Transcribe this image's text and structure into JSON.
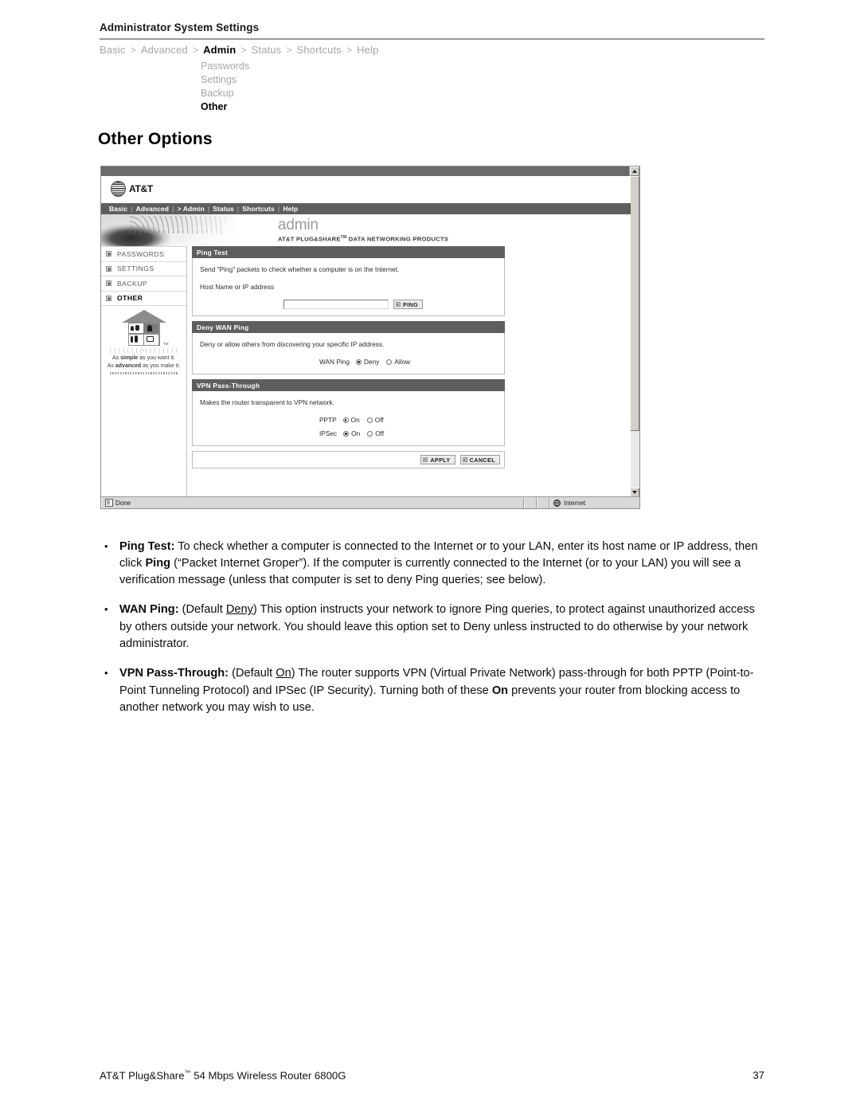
{
  "page": {
    "header_title": "Administrator System Settings",
    "section_heading": "Other Options"
  },
  "breadcrumb": {
    "items": [
      {
        "label": "Basic",
        "active": false
      },
      {
        "label": "Advanced",
        "active": false
      },
      {
        "label": "Admin",
        "active": true
      },
      {
        "label": "Status",
        "active": false
      },
      {
        "label": "Shortcuts",
        "active": false
      },
      {
        "label": "Help",
        "active": false
      }
    ],
    "separator": ">"
  },
  "subnav": {
    "items": [
      {
        "label": "Passwords",
        "active": false
      },
      {
        "label": "Settings",
        "active": false
      },
      {
        "label": "Backup",
        "active": false
      },
      {
        "label": "Other",
        "active": true
      }
    ]
  },
  "screenshot": {
    "brand": {
      "name": "AT&T",
      "logo_icon": "att-globe-icon"
    },
    "nav": {
      "items": [
        "Basic",
        "Advanced",
        "> Admin",
        "Status",
        "Shortcuts",
        "Help"
      ],
      "divider": "|"
    },
    "banner": {
      "title": "admin",
      "subtitle": "AT&T PLUG&SHARE",
      "subtitle_tm": "TM",
      "subtitle_rest": " DATA NETWORKING PRODUCTS"
    },
    "sidebar": {
      "items": [
        {
          "label": "PASSWORDS",
          "active": false
        },
        {
          "label": "SETTINGS",
          "active": false
        },
        {
          "label": "BACKUP",
          "active": false
        },
        {
          "label": "OTHER",
          "active": true
        }
      ],
      "promo": {
        "tm": "TM",
        "dots": "( ( ( ( ( ( ( (•) ) ) ) ) ) ) )",
        "tagline_line1_pre": "As ",
        "tagline_line1_bold": "simple",
        "tagline_line1_post": " as you want it.",
        "tagline_line2_pre": "As ",
        "tagline_line2_bold": "advanced",
        "tagline_line2_post": " as you make it."
      }
    },
    "panels": [
      {
        "title": "Ping Test",
        "description": "Send \"Ping\" packets to check whether a computer is on the Internet.",
        "field_label": "Host Name or IP address",
        "input_value": "",
        "input_placeholder": "",
        "button_label": "PING"
      },
      {
        "title": "Deny WAN Ping",
        "description": "Deny or allow others from discovering your specific IP address.",
        "radio_label": "WAN Ping",
        "options": [
          {
            "label": "Deny",
            "selected": true
          },
          {
            "label": "Allow",
            "selected": false
          }
        ]
      },
      {
        "title": "VPN Pass-Through",
        "description": "Makes the router transparent to VPN network.",
        "rows": [
          {
            "label": "PPTP",
            "options": [
              {
                "label": "On",
                "selected": true
              },
              {
                "label": "Off",
                "selected": false
              }
            ]
          },
          {
            "label": "IPSec",
            "options": [
              {
                "label": "On",
                "selected": true
              },
              {
                "label": "Off",
                "selected": false
              }
            ]
          }
        ]
      }
    ],
    "actions": {
      "apply_label": "APPLY",
      "cancel_label": "CANCEL"
    },
    "status_bar": {
      "message": "Done",
      "zone": "Internet",
      "zone_icon": "globe-icon",
      "doc_icon": "document-icon"
    }
  },
  "body": {
    "bullets": [
      {
        "term": "Ping Test:",
        "html": " To check whether a computer is connected to the Internet or to your LAN, enter its host name or IP address, then click <b>Ping</b> (“Packet Internet Groper”). If the computer is currently connected to the Internet (or to your LAN) you will see a verification message (unless that computer is set to deny Ping queries; see below)."
      },
      {
        "term": "WAN Ping:",
        "html": " (Default <u>Deny</u>) This option instructs your network to ignore Ping queries, to protect against unauthorized access by others outside your network. You should leave this option set to Deny unless instructed to do otherwise by your network administrator."
      },
      {
        "term": "VPN Pass-Through:",
        "html": " (Default <u>On</u>) The router supports VPN (Virtual Private Network) pass-through for both PPTP (Point-to-Point Tunneling Protocol) and IPSec (IP Security). Turning both of these <b>On</b> prevents your router from blocking access to another network you may wish to use."
      }
    ]
  },
  "footer": {
    "product": "AT&T Plug&Share",
    "product_tm": "™",
    "product_rest": " 54 Mbps Wireless Router 6800G",
    "page_number": "37"
  }
}
